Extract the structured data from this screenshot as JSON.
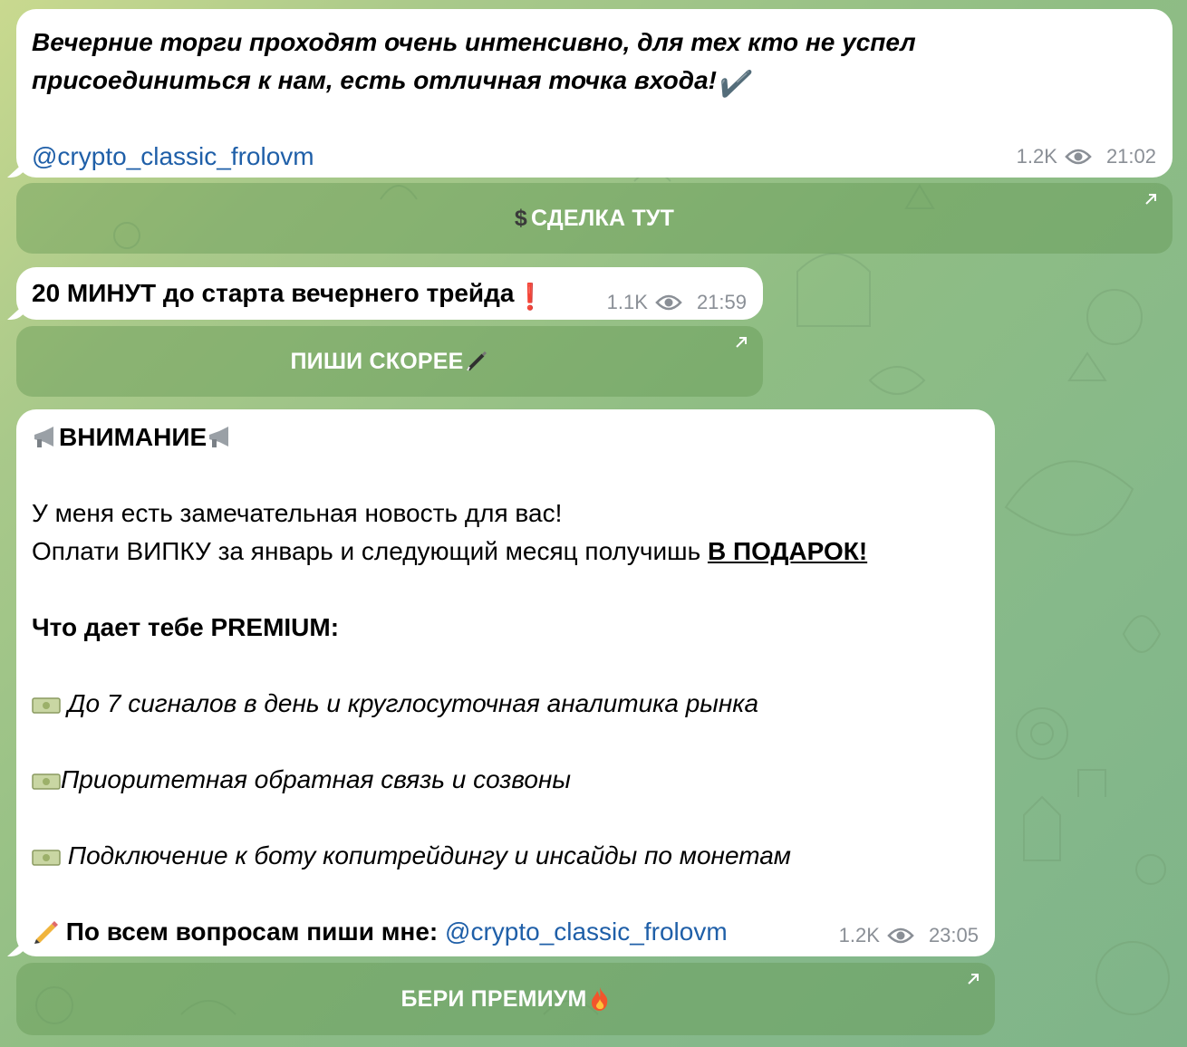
{
  "messages": [
    {
      "text_line1": "Вечерние торги проходят очень интенсивно, для тех кто не успел",
      "text_line2": "присоединиться к нам, есть отличная точка входа!",
      "text_line2_emoji": "✔️",
      "link": "@crypto_classic_frolovm",
      "views": "1.2K",
      "time": "21:02",
      "button": {
        "label": "СДЕЛКА ТУТ",
        "prefix_icon": "dollar-sign-icon"
      }
    },
    {
      "text": "20 МИНУТ до старта вечернего трейда",
      "text_emoji": "❗",
      "views": "1.1K",
      "time": "21:59",
      "button": {
        "label": "ПИШИ СКОРЕЕ",
        "suffix_icon": "pen-icon"
      }
    },
    {
      "heading": "ВНИМАНИЕ",
      "heading_icon": "megaphone-icon",
      "line1": "У меня есть замечательная новость для вас!",
      "line2_prefix": "Оплати ВИПКУ за январь и следующий месяц получишь ",
      "line2_highlight": "В ПОДАРОК!",
      "premium_title": "Что дает тебе PREMIUM:",
      "bullet_icon": "money-icon",
      "bullets": [
        " До 7 сигналов в день и круглосуточная аналитика рынка",
        "Приоритетная обратная связь и созвоны",
        " Подключение к боту копитрейдингу  и инсайды по монетам"
      ],
      "contact_prefix": " По всем вопросам пиши мне: ",
      "contact_icon": "pencil-icon",
      "link": "@crypto_classic_frolovm",
      "views": "1.2K",
      "time": "23:05",
      "button": {
        "label": "БЕРИ ПРЕМИУМ",
        "suffix_icon": "fire-icon"
      }
    }
  ],
  "colors": {
    "link": "#1f5fa8",
    "meta": "#8a8f96",
    "button_bg": "#6e9b5c"
  }
}
